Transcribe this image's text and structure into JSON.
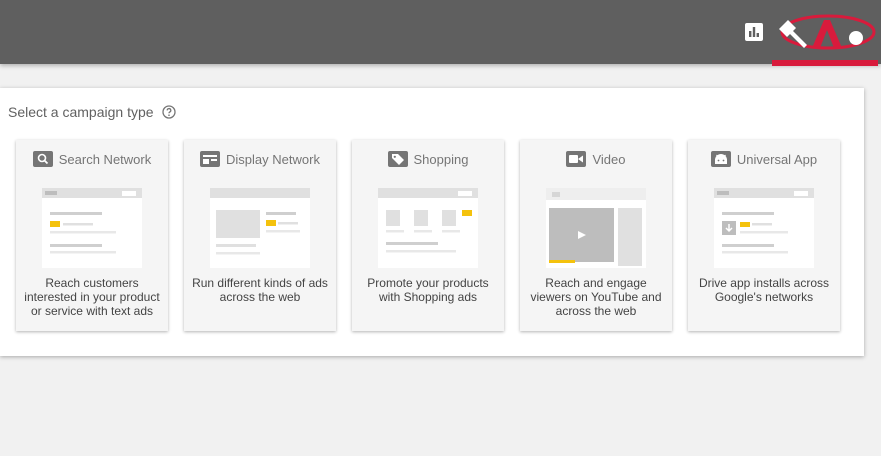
{
  "header": {
    "reports_icon": "bar-chart-icon",
    "tools_icon": "wrench-icon",
    "logo_name": "watermark-logo"
  },
  "panel": {
    "title": "Select a campaign type",
    "help_icon": "help-circle-icon"
  },
  "campaign_types": [
    {
      "label": "Search Network",
      "icon": "search-icon",
      "description": "Reach customers interested in your product or service with text ads"
    },
    {
      "label": "Display Network",
      "icon": "display-icon",
      "description": "Run different kinds of ads across the web"
    },
    {
      "label": "Shopping",
      "icon": "shopping-tag-icon",
      "description": "Promote your products with Shopping ads"
    },
    {
      "label": "Video",
      "icon": "video-camera-icon",
      "description": "Reach and engage viewers on YouTube and across the web"
    },
    {
      "label": "Universal App",
      "icon": "android-icon",
      "description": "Drive app installs across Google's networks"
    }
  ],
  "colors": {
    "topbar": "#5f5f5f",
    "accent_yellow": "#f4c20d",
    "logo_red": "#d81b3c"
  }
}
